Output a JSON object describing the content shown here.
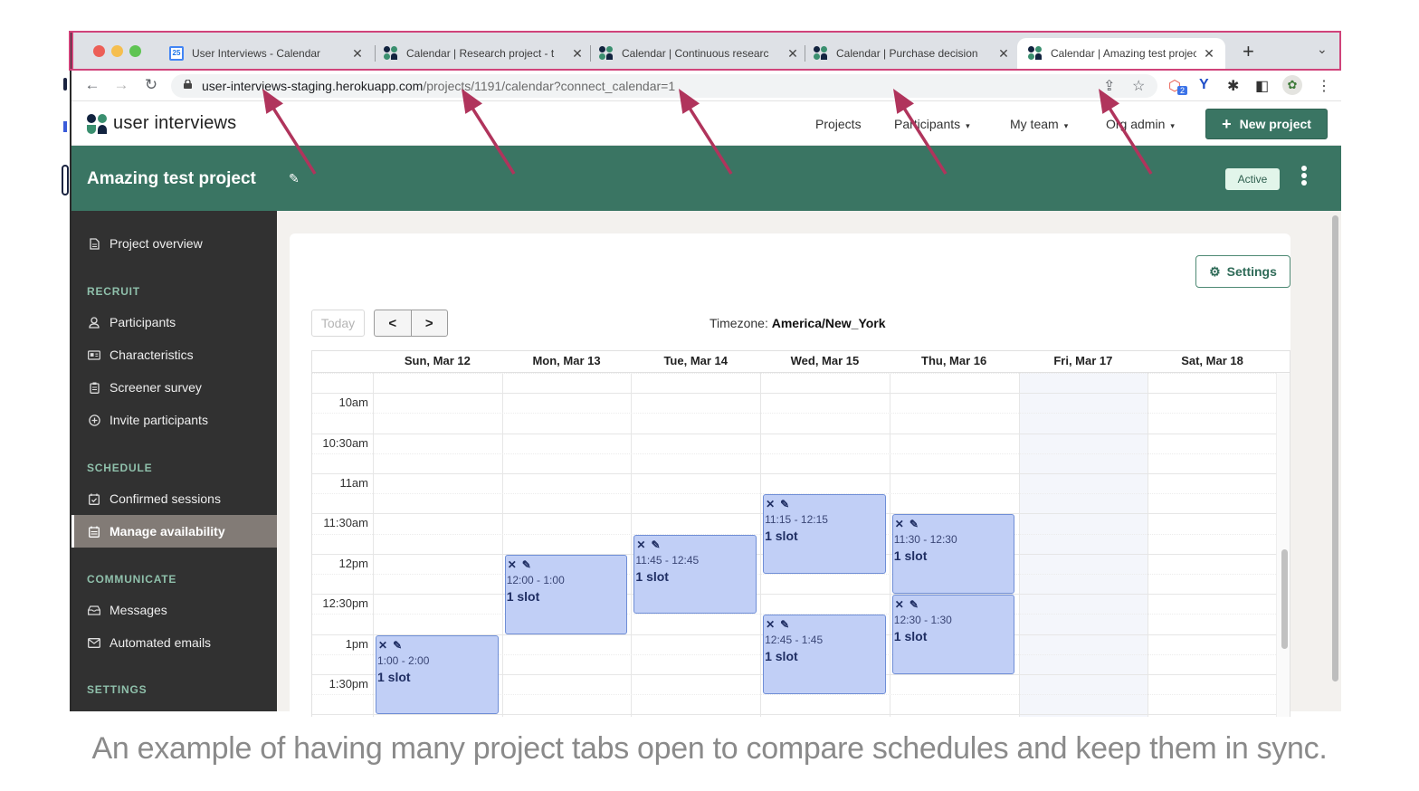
{
  "browser": {
    "tabs": [
      {
        "label": "User Interviews - Calendar",
        "icon": "google-calendar-icon",
        "active": false
      },
      {
        "label": "Calendar | Research project - t",
        "icon": "user-interviews-icon",
        "active": false
      },
      {
        "label": "Calendar | Continuous researc",
        "icon": "user-interviews-icon",
        "active": false
      },
      {
        "label": "Calendar | Purchase decision",
        "icon": "user-interviews-icon",
        "active": false
      },
      {
        "label": "Calendar | Amazing test projec",
        "icon": "user-interviews-icon",
        "active": true
      }
    ],
    "new_tab_glyph": "+",
    "tab_list_glyph": "⌄",
    "close_glyph": "✕",
    "calendar_favicon_text": "25",
    "url_host": "user-interviews-staging.herokuapp.com",
    "url_path": "/projects/1191/calendar?connect_calendar=1",
    "nav": {
      "back": "←",
      "forward": "→",
      "reload": "↻"
    },
    "toolbar_icons": [
      {
        "name": "share-icon",
        "glyph": "⇪"
      },
      {
        "name": "bookmark-star-icon",
        "glyph": "☆"
      },
      {
        "name": "extension-badge-icon",
        "glyph": "⬡",
        "badge": "2"
      },
      {
        "name": "extension-vee-icon",
        "glyph": "Y"
      },
      {
        "name": "extensions-puzzle-icon",
        "glyph": "✱"
      },
      {
        "name": "side-panel-icon",
        "glyph": "◧"
      },
      {
        "name": "profile-avatar-icon",
        "glyph": "✿"
      },
      {
        "name": "browser-menu-icon",
        "glyph": "⋮"
      }
    ]
  },
  "app": {
    "logo_text": "user interviews",
    "nav": [
      {
        "label": "Projects",
        "dropdown": false
      },
      {
        "label": "Participants",
        "dropdown": true
      },
      {
        "label": "My team",
        "dropdown": true
      },
      {
        "label": "Org admin",
        "dropdown": true
      }
    ],
    "caret_glyph": "▾",
    "new_project_label": "New project",
    "new_project_glyph": "+",
    "brand_color": "#3a7563"
  },
  "project": {
    "title": "Amazing test project",
    "edit_glyph": "✎",
    "status": "Active"
  },
  "sidebar": {
    "top_items": [
      {
        "label": "Project overview",
        "icon": "document-icon",
        "glyph": "🗎"
      }
    ],
    "sections": [
      {
        "heading": "RECRUIT",
        "items": [
          {
            "label": "Participants",
            "icon": "person-icon",
            "glyph": "⚇",
            "active": false
          },
          {
            "label": "Characteristics",
            "icon": "id-card-icon",
            "glyph": "▤",
            "active": false
          },
          {
            "label": "Screener survey",
            "icon": "clipboard-icon",
            "glyph": "▦",
            "active": false
          },
          {
            "label": "Invite participants",
            "icon": "plus-circle-icon",
            "glyph": "⊕",
            "active": false
          }
        ]
      },
      {
        "heading": "SCHEDULE",
        "items": [
          {
            "label": "Confirmed sessions",
            "icon": "calendar-check-icon",
            "glyph": "☑",
            "active": false
          },
          {
            "label": "Manage availability",
            "icon": "calendar-icon",
            "glyph": "▦",
            "active": true
          }
        ]
      },
      {
        "heading": "COMMUNICATE",
        "items": [
          {
            "label": "Messages",
            "icon": "inbox-icon",
            "glyph": "⌂",
            "active": false
          },
          {
            "label": "Automated emails",
            "icon": "envelope-icon",
            "glyph": "✉",
            "active": false
          }
        ]
      },
      {
        "heading": "SETTINGS",
        "items": []
      }
    ]
  },
  "calendar": {
    "settings_label": "Settings",
    "settings_glyph": "⚙",
    "today_label": "Today",
    "prev_glyph": "<",
    "next_glyph": ">",
    "timezone_label": "Timezone:",
    "timezone_value": "America/New_York",
    "days": [
      "Sun, Mar 12",
      "Mon, Mar 13",
      "Tue, Mar 14",
      "Wed, Mar 15",
      "Thu, Mar 16",
      "Fri, Mar 17",
      "Sat, Mar 18"
    ],
    "highlighted_day_index": 5,
    "time_labels": [
      "10am",
      "10:30am",
      "11am",
      "11:30am",
      "12pm",
      "12:30pm",
      "1pm",
      "1:30pm"
    ],
    "first_visible_hour": 9.75,
    "events": [
      {
        "day": 0,
        "start": 13.0,
        "end": 14.0,
        "time": "1:00 - 2:00",
        "slots": "1 slot"
      },
      {
        "day": 1,
        "start": 12.0,
        "end": 13.0,
        "time": "12:00 - 1:00",
        "slots": "1 slot"
      },
      {
        "day": 2,
        "start": 11.75,
        "end": 12.75,
        "time": "11:45 - 12:45",
        "slots": "1 slot"
      },
      {
        "day": 3,
        "start": 11.25,
        "end": 12.25,
        "time": "11:15 - 12:15",
        "slots": "1 slot"
      },
      {
        "day": 3,
        "start": 12.75,
        "end": 13.75,
        "time": "12:45 - 1:45",
        "slots": "1 slot"
      },
      {
        "day": 4,
        "start": 11.5,
        "end": 12.5,
        "time": "11:30 - 12:30",
        "slots": "1 slot"
      },
      {
        "day": 4,
        "start": 12.5,
        "end": 13.5,
        "time": "12:30 - 1:30",
        "slots": "1 slot"
      }
    ],
    "event_delete_glyph": "✕",
    "event_edit_glyph": "✎",
    "event_color": "#c1cff6"
  },
  "annotation": {
    "arrow_color": "#b0345c",
    "highlight_color": "#d0437a",
    "caption": "An example of having many project tabs open to compare schedules and keep them in sync."
  }
}
